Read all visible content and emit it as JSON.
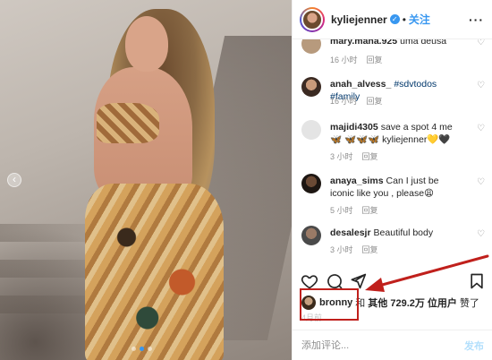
{
  "post": {
    "image_alt": "photo",
    "carousel_dots": 3,
    "active_dot": 1
  },
  "header": {
    "username": "kyliejenner",
    "verified_glyph": "✓",
    "separator": "•",
    "follow_label": "关注",
    "more_icon": "more-horizontal-icon"
  },
  "comments": [
    {
      "username": "mary.mana.925",
      "text": "uma deusa",
      "time": "16 小时",
      "reply": "回复"
    },
    {
      "username": "anah_alvess_",
      "text": "#sdvtodos #family",
      "time": "16 小时",
      "reply": "回复"
    },
    {
      "username": "majidi4305",
      "text": "save a spot 4 me 🦋 🦋🦋🦋 kyliejenner💛🖤",
      "time": "3 小时",
      "reply": "回复"
    },
    {
      "username": "anaya_sims",
      "text": "Can I just be iconic like you , please😩",
      "time": "5 小时",
      "reply": "回复"
    },
    {
      "username": "desalesjr",
      "text": "Beautiful body",
      "time": "3 小时",
      "reply": "回复"
    }
  ],
  "likes": {
    "liker": "bronny",
    "and": "和",
    "others": "其他 729.2万 位用户",
    "suffix": "赞了"
  },
  "time_ago": "4月前",
  "add_comment": {
    "placeholder": "添加评论...",
    "post_label": "发布"
  },
  "colors": {
    "link_blue": "#3897f0",
    "annotation_red": "#c0201c"
  }
}
